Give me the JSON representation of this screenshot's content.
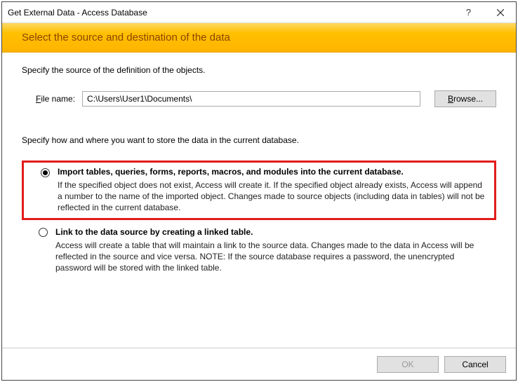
{
  "titlebar": {
    "title": "Get External Data - Access Database"
  },
  "banner": {
    "heading": "Select the source and destination of the data"
  },
  "source": {
    "label": "Specify the source of the definition of the objects.",
    "file_prefix": "F",
    "file_rest": "ile name:",
    "file_value": "C:\\Users\\User1\\Documents\\",
    "browse_prefix": "B",
    "browse_rest": "rowse..."
  },
  "store": {
    "label": "Specify how and where you want to store the data in the current database."
  },
  "options": {
    "import": {
      "title": "Import tables, queries, forms, reports, macros, and modules into the current database.",
      "desc": "If the specified object does not exist, Access will create it. If the specified object already exists, Access will append a number to the name of the imported object. Changes made to source objects (including data in tables) will not be reflected in the current database."
    },
    "link": {
      "title": "Link to the data source by creating a linked table.",
      "desc": "Access will create a table that will maintain a link to the source data. Changes made to the data in Access will be reflected in the source and vice versa. NOTE:  If the source database requires a password, the unencrypted password will be stored with the linked table."
    }
  },
  "footer": {
    "ok": "OK",
    "cancel": "Cancel"
  }
}
